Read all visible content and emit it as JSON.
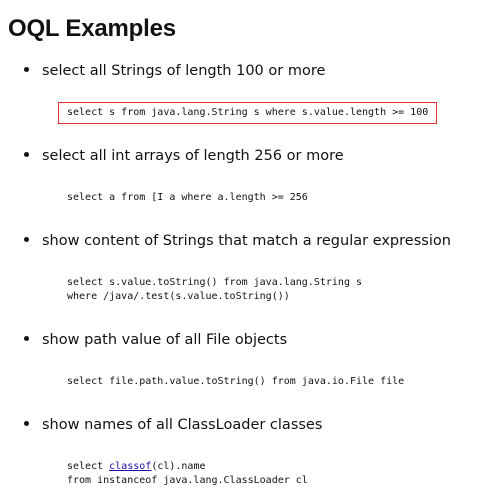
{
  "page": {
    "title": "OQL Examples"
  },
  "examples": [
    {
      "description": "select all Strings of length 100 or more",
      "code_lines": [
        "select s from java.lang.String s where s.value.length >= 100"
      ]
    },
    {
      "description": "select all int arrays of length 256 or more",
      "code_lines": [
        "select a from [I a where a.length >= 256"
      ]
    },
    {
      "description": "show content of Strings that match a regular expression",
      "code_lines": [
        "select s.value.toString() from java.lang.String s",
        "where /java/.test(s.value.toString())"
      ]
    },
    {
      "description": "show path value of all File objects",
      "code_lines": [
        "select file.path.value.toString() from java.io.File file"
      ]
    },
    {
      "description": "show names of all ClassLoader classes",
      "code_lines": [
        "select ",
        "(cl).name",
        "from instanceof java.lang.ClassLoader cl"
      ],
      "link_text": "classof"
    }
  ],
  "colors": {
    "highlight_border": "#e03030",
    "link": "#1a0dab"
  }
}
